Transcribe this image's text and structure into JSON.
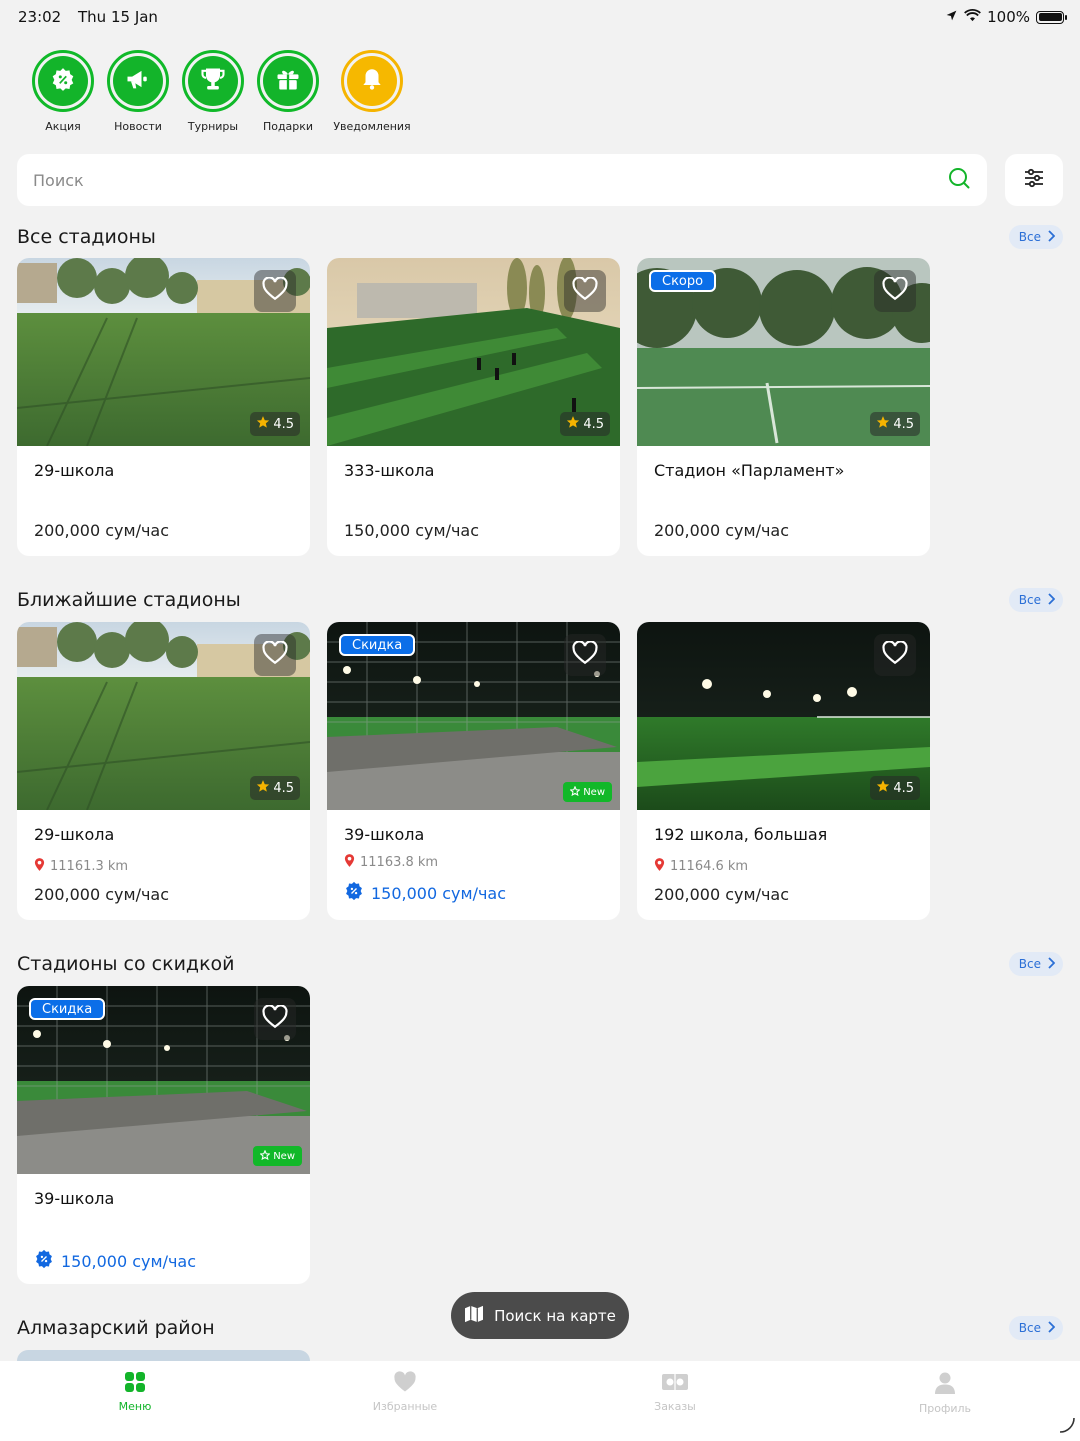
{
  "status": {
    "time": "23:02",
    "date": "Thu 15 Jan",
    "battery": "100%"
  },
  "categories": [
    {
      "label": "Акция",
      "icon": "discount-icon"
    },
    {
      "label": "Новости",
      "icon": "megaphone-icon"
    },
    {
      "label": "Турниры",
      "icon": "trophy-icon"
    },
    {
      "label": "Подарки",
      "icon": "gift-icon"
    },
    {
      "label": "Уведомления",
      "icon": "bell-icon"
    }
  ],
  "search": {
    "placeholder": "Поиск"
  },
  "sections": {
    "all": {
      "title": "Все стадионы",
      "see_all": "Все",
      "cards": [
        {
          "name": "29-школа",
          "price": "200,000 сум/час",
          "rating": "4.5"
        },
        {
          "name": "333-школа",
          "price": "150,000 сум/час",
          "rating": "4.5"
        },
        {
          "name": "Стадион «Парламент»",
          "price": "200,000 сум/час",
          "rating": "4.5",
          "badge": "Скоро"
        }
      ]
    },
    "nearby": {
      "title": "Ближайшие стадионы",
      "see_all": "Все",
      "cards": [
        {
          "name": "29-школа",
          "distance": "11161.3 km",
          "price": "200,000 сум/час",
          "rating": "4.5"
        },
        {
          "name": "39-школа",
          "distance": "11163.8 km",
          "price": "150,000 сум/час",
          "badge": "Скидка",
          "new_badge": "New"
        },
        {
          "name": "192 школа, большая",
          "distance": "11164.6 km",
          "price": "200,000 сум/час",
          "rating": "4.5"
        }
      ]
    },
    "discount": {
      "title": "Стадионы со скидкой",
      "see_all": "Все",
      "cards": [
        {
          "name": "39-школа",
          "price": "150,000 сум/час",
          "badge": "Скидка",
          "new_badge": "New"
        }
      ]
    },
    "district": {
      "title": "Алмазарский район",
      "see_all": "Все"
    }
  },
  "map_button": {
    "label": "Поиск на карте"
  },
  "tabs": [
    {
      "label": "Меню",
      "icon": "grid-icon",
      "active": true
    },
    {
      "label": "Избранные",
      "icon": "heart-icon"
    },
    {
      "label": "Заказы",
      "icon": "ticket-icon"
    },
    {
      "label": "Профиль",
      "icon": "user-icon"
    }
  ],
  "colors": {
    "brand_green": "#13b42a",
    "accent_blue": "#0b6ee8",
    "notify_orange": "#f6b800"
  }
}
